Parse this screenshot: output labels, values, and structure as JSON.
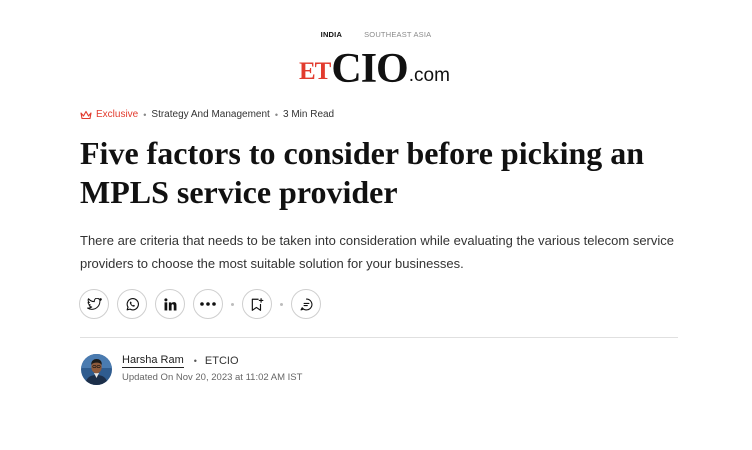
{
  "region_tabs": [
    {
      "label": "INDIA",
      "active": true
    },
    {
      "label": "SOUTHEAST ASIA",
      "active": false
    }
  ],
  "logo": {
    "prefix": "ET",
    "main": "CIO",
    "suffix": ".com",
    "prefix_color": "#e23b2e"
  },
  "meta": {
    "exclusive_label": "Exclusive",
    "exclusive_icon": "crown-icon",
    "category": "Strategy And Management",
    "read_time": "3 Min Read",
    "separator": "•"
  },
  "article": {
    "headline": "Five factors to consider before picking an MPLS service provider",
    "summary": "There are criteria that needs to be taken into consideration while evaluating the various telecom service providers to choose the most suitable solution for your businesses."
  },
  "share": {
    "buttons": [
      "twitter-icon",
      "whatsapp-icon",
      "linkedin-icon",
      "more-icon",
      "bookmark-add-icon",
      "comment-icon"
    ]
  },
  "author": {
    "name": "Harsha Ram",
    "separator": "•",
    "publication": "ETCIO",
    "updated": "Updated On Nov 20, 2023 at 11:02 AM IST"
  },
  "colors": {
    "accent": "#e23b2e",
    "text": "#111111",
    "muted": "#666666"
  }
}
